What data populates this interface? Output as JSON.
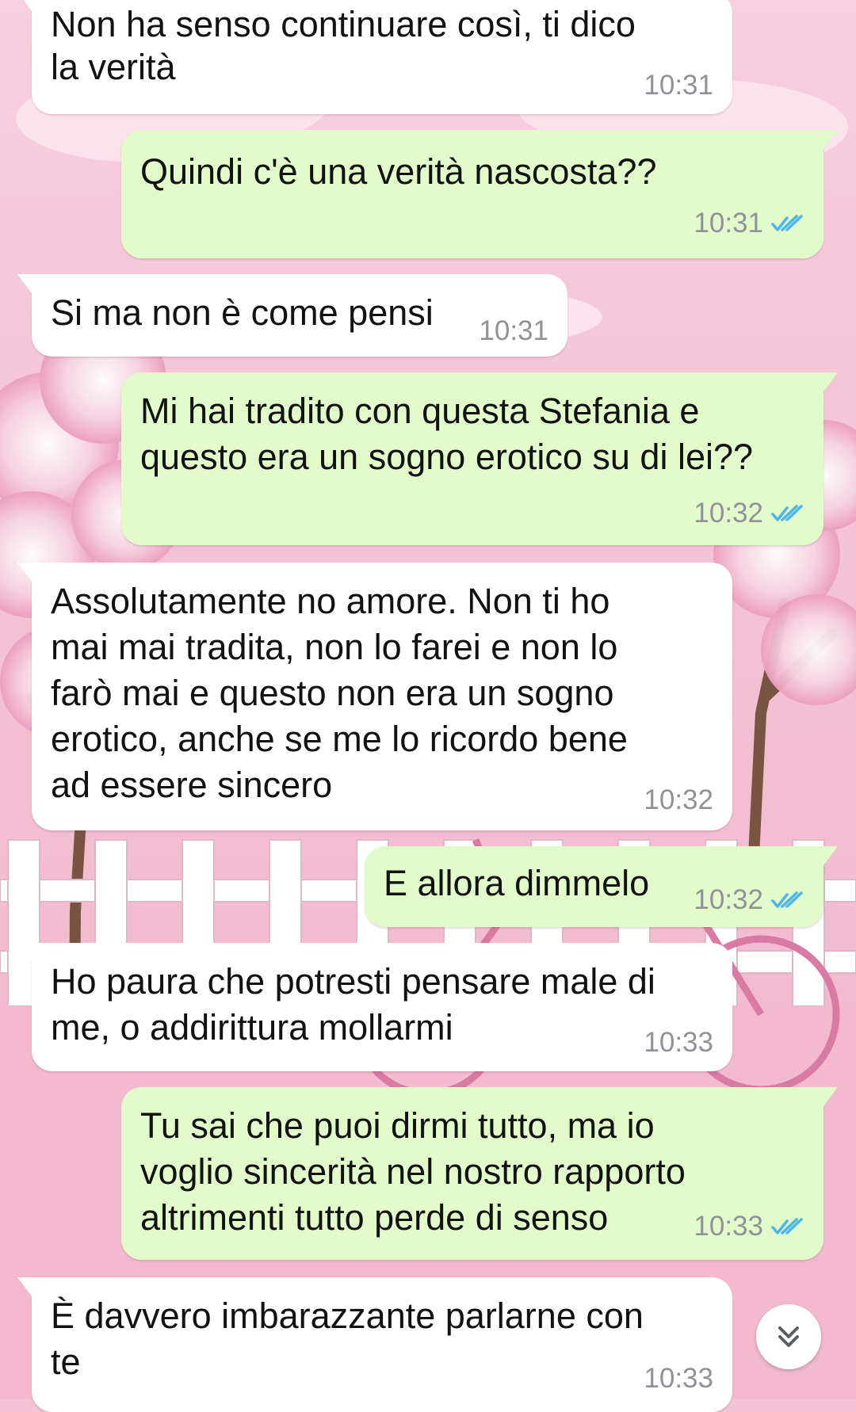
{
  "chat": {
    "messages": [
      {
        "direction": "incoming",
        "lines": [
          "Non ha senso continuare così, ti dico",
          "la verità"
        ],
        "time": "10:31"
      },
      {
        "direction": "outgoing",
        "lines": [
          "Quindi c'è una verità nascosta??"
        ],
        "time": "10:31",
        "status": "read"
      },
      {
        "direction": "incoming",
        "lines": [
          "Si ma non è come pensi"
        ],
        "time": "10:31"
      },
      {
        "direction": "outgoing",
        "lines": [
          "Mi hai tradito con questa Stefania e",
          "questo era un sogno erotico su di lei??"
        ],
        "time": "10:32",
        "status": "read"
      },
      {
        "direction": "incoming",
        "lines": [
          "Assolutamente no amore. Non ti ho",
          "mai mai tradita, non lo farei e non lo",
          "farò mai e questo non era un sogno",
          "erotico, anche se me lo ricordo bene",
          "ad essere sincero"
        ],
        "time": "10:32"
      },
      {
        "direction": "outgoing",
        "lines": [
          "E allora dimmelo"
        ],
        "time": "10:32",
        "status": "read"
      },
      {
        "direction": "incoming",
        "lines": [
          "Ho paura che potresti pensare male di",
          "me, o addirittura mollarmi"
        ],
        "time": "10:33"
      },
      {
        "direction": "outgoing",
        "lines": [
          "Tu sai che puoi dirmi tutto, ma io",
          "voglio sincerità nel nostro rapporto",
          "altrimenti tutto perde di senso"
        ],
        "time": "10:33",
        "status": "read"
      },
      {
        "direction": "incoming",
        "lines": [
          "È davvero imbarazzante parlarne con",
          "te"
        ],
        "time": "10:33"
      }
    ]
  },
  "icons": {
    "read_receipt": "double-check-icon",
    "scroll_down": "chevron-double-down-icon"
  },
  "colors": {
    "incoming_bubble": "#ffffff",
    "outgoing_bubble": "#e2fbcb",
    "read_tick": "#4fb6ec",
    "timestamp": "#8f9296",
    "wallpaper_pink": "#f4c3d6"
  }
}
